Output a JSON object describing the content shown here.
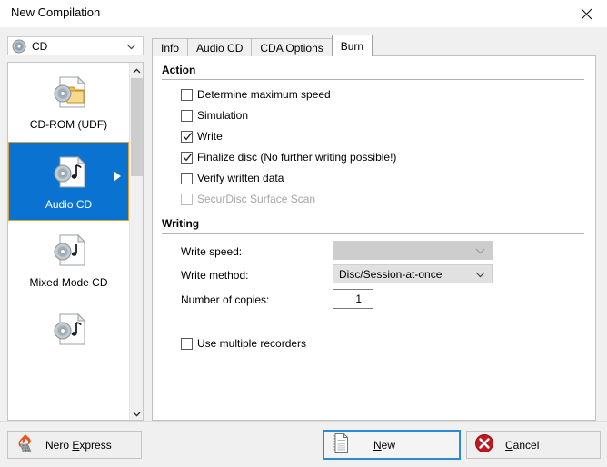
{
  "window": {
    "title": "New Compilation",
    "close_icon": "close-icon"
  },
  "media_combo": {
    "icon": "cd-disc-icon",
    "value": "CD",
    "arrow_icon": "chevron-down-icon"
  },
  "compilation_list": {
    "items": [
      {
        "label": "CD-ROM (UDF)",
        "icon": "cd-folder-document-icon",
        "selected": false
      },
      {
        "label": "Audio CD",
        "icon": "cd-music-document-icon",
        "selected": true
      },
      {
        "label": "Mixed Mode CD",
        "icon": "cd-note-document-icon",
        "selected": false
      },
      {
        "label": "",
        "icon": "cd-music-document-icon",
        "selected": false
      }
    ],
    "selected_arrow_icon": "play-arrow-icon",
    "scroll_up_icon": "chevron-up-icon",
    "scroll_down_icon": "chevron-down-icon"
  },
  "tabs": [
    {
      "label": "Info",
      "active": false
    },
    {
      "label": "Audio CD",
      "active": false
    },
    {
      "label": "CDA Options",
      "active": false
    },
    {
      "label": "Burn",
      "active": true
    }
  ],
  "burn": {
    "action": {
      "title": "Action",
      "options": [
        {
          "label": "Determine maximum speed",
          "checked": false,
          "disabled": false
        },
        {
          "label": "Simulation",
          "checked": false,
          "disabled": false
        },
        {
          "label": "Write",
          "checked": true,
          "disabled": false
        },
        {
          "label": "Finalize disc (No further writing possible!)",
          "checked": true,
          "disabled": false
        },
        {
          "label": "Verify written data",
          "checked": false,
          "disabled": false
        },
        {
          "label": "SecurDisc Surface Scan",
          "checked": false,
          "disabled": true
        }
      ]
    },
    "writing": {
      "title": "Writing",
      "write_speed_label": "Write speed:",
      "write_speed_value": "",
      "write_speed_disabled": true,
      "write_method_label": "Write method:",
      "write_method_value": "Disc/Session-at-once",
      "number_of_copies_label": "Number of copies:",
      "number_of_copies_value": "1",
      "use_multiple_recorders_label": "Use multiple recorders",
      "use_multiple_recorders_checked": false,
      "dropdown_arrow_icon": "chevron-down-icon"
    }
  },
  "footer": {
    "nero_express_label": "Nero Express",
    "nero_express_icon": "nero-flame-icon",
    "new_label": "New",
    "new_icon": "document-page-icon",
    "cancel_label": "Cancel",
    "cancel_icon": "error-circle-icon"
  },
  "colors": {
    "selection_blue": "#0a73d1",
    "selection_border": "#d8a13a",
    "default_button_border": "#2a8ad4",
    "cancel_red": "#c0181f",
    "window_bg": "#f0f0f0",
    "panel_white": "#ffffff"
  }
}
